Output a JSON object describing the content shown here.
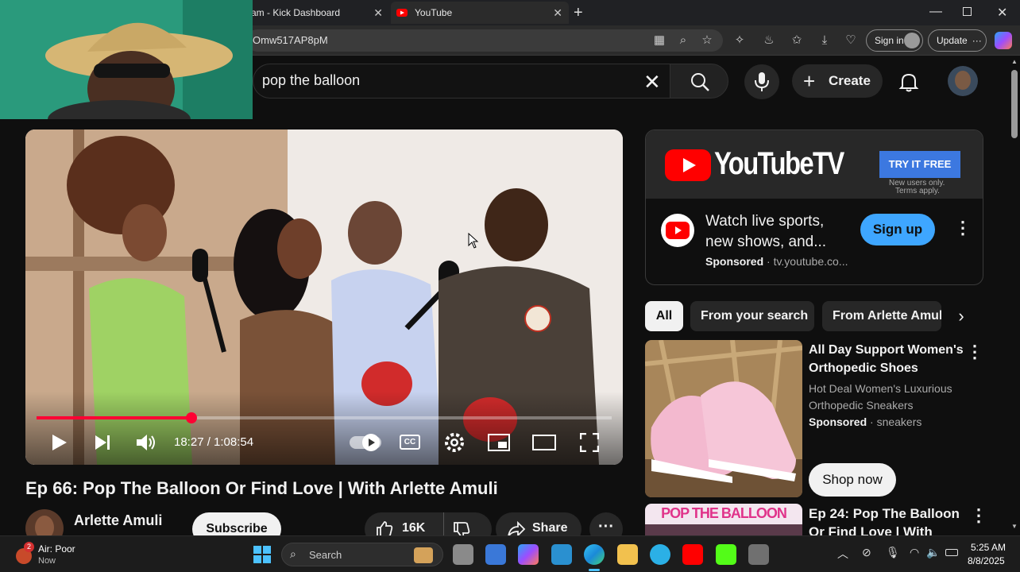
{
  "browser": {
    "tabs": [
      {
        "label": "am - Kick Dashboard"
      },
      {
        "label": "YouTube"
      }
    ],
    "url_fragment": "Omw517AP8pM",
    "sign_in_label": "Sign in",
    "update_label": "Update"
  },
  "youtube": {
    "search_value": "pop the balloon",
    "create_label": "Create"
  },
  "player": {
    "current_time": "18:27",
    "duration": "1:08:54",
    "time_display": "18:27 / 1:08:54",
    "progress_fraction": 0.27
  },
  "video": {
    "title": "Ep 66: Pop The Balloon Or Find Love | With Arlette Amuli",
    "channel": "Arlette Amuli",
    "subscribe_label": "Subscribe",
    "likes": "16K",
    "share_label": "Share"
  },
  "ad": {
    "brand": "YouTubeTV",
    "cta": "TRY IT FREE",
    "fineprint_1": "New users only.",
    "fineprint_2": "Terms apply.",
    "headline_1": "Watch live sports,",
    "headline_2": "new shows, and...",
    "sponsored_label": "Sponsored",
    "domain": "· tv.youtube.co...",
    "signup_label": "Sign up"
  },
  "chips": [
    {
      "label": "All"
    },
    {
      "label": "From your search"
    },
    {
      "label": "From Arlette Amuli"
    }
  ],
  "sidebar_items": [
    {
      "title_1": "All Day Support Women's",
      "title_2": "Orthopedic Shoes",
      "desc_1": "Hot Deal Women's Luxurious",
      "desc_2": "Orthopedic Sneakers",
      "sponsored_label": "Sponsored",
      "source": "· sneakers",
      "button_label": "Shop now"
    },
    {
      "title_1": "Ep 24: Pop The Balloon",
      "title_2": "Or Find Love | With",
      "thumb_text": "POP THE BALLOON"
    }
  ],
  "taskbar": {
    "weather_badge": "2",
    "weather_title": "Air: Poor",
    "weather_sub": "Now",
    "search_placeholder": "Search",
    "time": "5:25 AM",
    "date": "8/8/2025"
  },
  "colors": {
    "yt_red": "#ff0000",
    "progress_red": "#ff0033",
    "signup_blue": "#3ea6ff",
    "ad_cta_blue": "#3c78e0"
  }
}
